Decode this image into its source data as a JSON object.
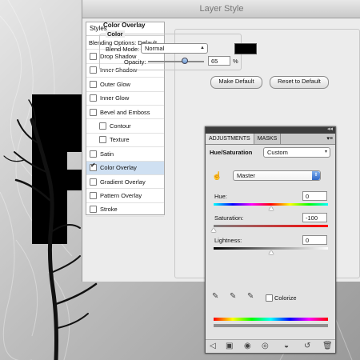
{
  "dialog": {
    "title": "Layer Style",
    "styles_header": "Styles",
    "blending_options": "Blending Options: Default",
    "styles": [
      {
        "label": "Drop Shadow",
        "checked": false
      },
      {
        "label": "Inner Shadow",
        "checked": false
      },
      {
        "label": "Outer Glow",
        "checked": false
      },
      {
        "label": "Inner Glow",
        "checked": false
      },
      {
        "label": "Bevel and Emboss",
        "checked": false
      },
      {
        "label": "Contour",
        "checked": false
      },
      {
        "label": "Texture",
        "checked": false
      },
      {
        "label": "Satin",
        "checked": false
      },
      {
        "label": "Color Overlay",
        "checked": true
      },
      {
        "label": "Gradient Overlay",
        "checked": false
      },
      {
        "label": "Pattern Overlay",
        "checked": false
      },
      {
        "label": "Stroke",
        "checked": false
      }
    ],
    "color_overlay": {
      "section_title": "Color Overlay",
      "group_title": "Color",
      "blend_mode_label": "Blend Mode:",
      "blend_mode_value": "Normal",
      "overlay_color": "#000000",
      "opacity_label": "Opacity:",
      "opacity_value": "65",
      "opacity_unit": "%",
      "opacity_fraction": 0.65
    },
    "make_default": "Make Default",
    "reset_to_default": "Reset to Default"
  },
  "adjustments": {
    "tabs": [
      "ADJUSTMENTS",
      "MASKS"
    ],
    "menu_icon": "panel-menu-icon",
    "adjustment_name": "Hue/Saturation",
    "preset": "Custom",
    "channel": "Master",
    "hue": {
      "label": "Hue:",
      "value": "0",
      "range": [
        -180,
        180
      ]
    },
    "saturation": {
      "label": "Saturation:",
      "value": "-100",
      "range": [
        -100,
        100
      ]
    },
    "lightness": {
      "label": "Lightness:",
      "value": "0",
      "range": [
        -100,
        100
      ]
    },
    "colorize_label": "Colorize",
    "colorize_checked": false
  }
}
